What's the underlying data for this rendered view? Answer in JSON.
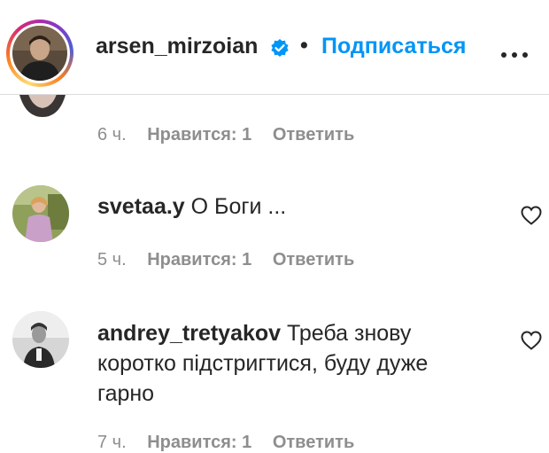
{
  "header": {
    "username": "arsen_mirzoian",
    "separator": "•",
    "follow_label": "Подписаться",
    "verified_icon": "verified-badge-icon",
    "more_icon": "more-options-icon"
  },
  "comments": [
    {
      "username": "",
      "text": "",
      "time": "6 ч.",
      "likes": "Нравится: 1",
      "reply": "Ответить"
    },
    {
      "username": "svetaa.y",
      "text": "О Боги ...",
      "time": "5 ч.",
      "likes": "Нравится: 1",
      "reply": "Ответить"
    },
    {
      "username": "andrey_tretyakov",
      "text": "Треба знову коротко підстригтися, буду дуже гарно",
      "time": "7 ч.",
      "likes": "Нравится: 1",
      "reply": "Ответить"
    }
  ],
  "colors": {
    "accent": "#0095f6",
    "text": "#262626",
    "secondary": "#8e8e8e",
    "border": "#dbdbdb"
  }
}
